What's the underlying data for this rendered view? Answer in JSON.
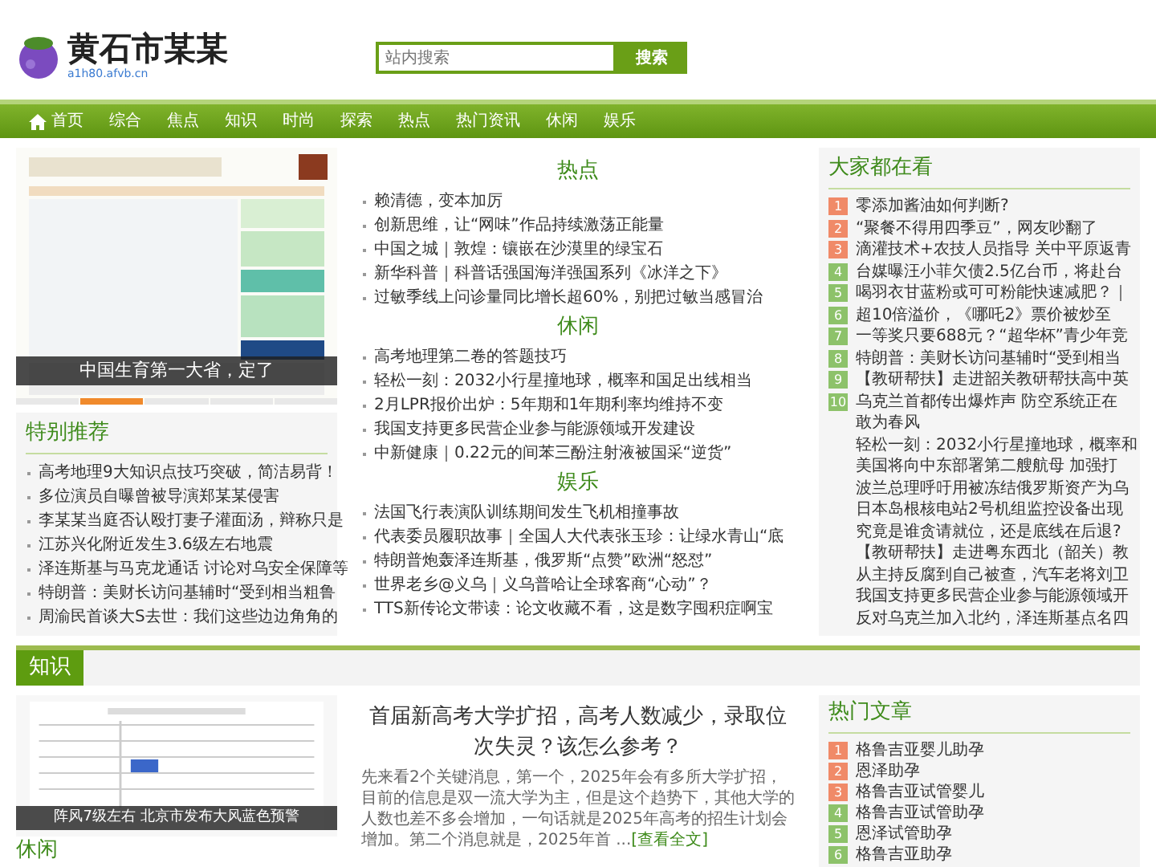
{
  "header": {
    "site_title": "黄石市某某",
    "site_url": "a1h80.afvb.cn",
    "search": {
      "placeholder": "站内搜索",
      "button": "搜索"
    }
  },
  "nav": [
    {
      "label": "首页",
      "kind": "home"
    },
    {
      "label": "综合",
      "kind": "link"
    },
    {
      "label": "焦点",
      "kind": "link"
    },
    {
      "label": "知识",
      "kind": "link"
    },
    {
      "label": "时尚",
      "kind": "link"
    },
    {
      "label": "探索",
      "kind": "link"
    },
    {
      "label": "热点",
      "kind": "link"
    },
    {
      "label": "热门资讯",
      "kind": "link"
    },
    {
      "label": "休闲",
      "kind": "link"
    },
    {
      "label": "娱乐",
      "kind": "link"
    }
  ],
  "carousel": {
    "kind": "picture",
    "caption": "中国生育第一大省，定了",
    "indicators": [
      {
        "selected": false
      },
      {
        "selected": true
      },
      {
        "selected": false
      },
      {
        "selected": false
      },
      {
        "selected": false
      }
    ]
  },
  "featured": {
    "title": "特别推荐",
    "items": [
      "高考地理9大知识点技巧突破，简洁易背！",
      "多位演员自曝曾被导演郑某某侵害",
      "李某某当庭否认殴打妻子灌面汤，辩称只是",
      "江苏兴化附近发生3.6级左右地震",
      "泽连斯基与马克龙通话 讨论对乌安全保障等",
      "特朗普：美财长访问基辅时“受到相当粗鲁",
      "周渝民首谈大S去世：我们这些边边角角的"
    ]
  },
  "sections": [
    {
      "title": "热点",
      "items": [
        "赖清德，变本加厉",
        "创新思维，让“网味”作品持续激荡正能量",
        "中国之城｜敦煌：镶嵌在沙漠里的绿宝石",
        "新华科普｜科普话强国海洋强国系列《冰洋之下》",
        "过敏季线上问诊量同比增长超60%，别把过敏当感冒治"
      ]
    },
    {
      "title": "休闲",
      "items": [
        "高考地理第二卷的答题技巧",
        "轻松一刻：2032小行星撞地球，概率和国足出线相当",
        "2月LPR报价出炉：5年期和1年期利率均维持不变",
        "我国支持更多民营企业参与能源领域开发建设",
        "中新健康｜0.22元的间苯三酚注射液被国采“逆货”"
      ]
    },
    {
      "title": "娱乐",
      "items": [
        "法国飞行表演队训练期间发生飞机相撞事故",
        "代表委员履职故事｜全国人大代表张玉珍：让绿水青山“底",
        "特朗普炮轰泽连斯基，俄罗斯“点赞”欧洲“怒怼”",
        "世界老乡@义乌｜义乌普哈让全球客商“心动”？",
        "TTS新传论文带读：论文收藏不看，这是数字囤积症啊宝"
      ]
    }
  ],
  "popular": {
    "title": "大家都在看",
    "items": [
      {
        "rank": "1",
        "color": "#f08a68",
        "text": "零添加酱油如何判断?"
      },
      {
        "rank": "2",
        "color": "#f08a68",
        "text": "“聚餐不得用四季豆”，网友吵翻了"
      },
      {
        "rank": "3",
        "color": "#f08a68",
        "text": "滴灌技术+农技人员指导 关中平原返青"
      },
      {
        "rank": "4",
        "color": "#8dc26a",
        "text": "台媒曝汪小菲欠债2.5亿台币，将赴台"
      },
      {
        "rank": "5",
        "color": "#8dc26a",
        "text": "喝羽衣甘蓝粉或可可粉能快速减肥？｜"
      },
      {
        "rank": "6",
        "color": "#8dc26a",
        "text": "超10倍溢价，《哪吒2》票价被炒至"
      },
      {
        "rank": "7",
        "color": "#8dc26a",
        "text": "一等奖只要688元？“超华杯”青少年竞"
      },
      {
        "rank": "8",
        "color": "#8dc26a",
        "text": "特朗普：美财长访问基辅时“受到相当"
      },
      {
        "rank": "9",
        "color": "#8dc26a",
        "text": "【教研帮扶】走进韶关教研帮扶高中英"
      },
      {
        "rank": "10",
        "color": "#8dc26a",
        "text": "乌克兰首都传出爆炸声 防空系统正在"
      }
    ],
    "more_lines": [
      "敢为春风",
      "轻松一刻：2032小行星撞地球，概率和",
      "美国将向中东部署第二艘航母 加强打",
      "波兰总理呼吁用被冻结俄罗斯资产为乌",
      "日本岛根核电站2号机组监控设备出现",
      "究竟是谁贪请就位，还是底线在后退?",
      "【教研帮扶】走进粤东西北（韶关）教",
      "从主持反腐到自己被查，汽车老将刘卫",
      "我国支持更多民营企业参与能源领域开",
      "反对乌克兰加入北约，泽连斯基点名四"
    ]
  },
  "knowledge": {
    "tab": "知识",
    "photo": {
      "kind": "picture",
      "caption": "阵风7级左右 北京市发布大风蓝色预警"
    },
    "side_heading": "休闲",
    "article": {
      "title": "首届新高考大学扩招，高考人数减少，录取位次失灵？该怎么参考？",
      "summary": "先来看2个关键消息，第一个，2025年会有多所大学扩招，目前的信息是双一流大学为主，但是这个趋势下，其他大学的人数也差不多会增加，一句话就是2025年高考的招生计划会增加。第二个消息就是，2025年首 ...",
      "more": "[查看全文]"
    },
    "hot": {
      "title": "热门文章",
      "items": [
        {
          "rank": "1",
          "color": "#f08a68",
          "text": "格鲁吉亚婴儿助孕"
        },
        {
          "rank": "2",
          "color": "#f08a68",
          "text": "恩泽助孕"
        },
        {
          "rank": "3",
          "color": "#f08a68",
          "text": "格鲁吉亚试管婴儿"
        },
        {
          "rank": "4",
          "color": "#8dc26a",
          "text": "格鲁吉亚试管助孕"
        },
        {
          "rank": "5",
          "color": "#8dc26a",
          "text": "恩泽试管助孕"
        },
        {
          "rank": "6",
          "color": "#8dc26a",
          "text": "格鲁吉亚助孕"
        }
      ]
    }
  }
}
